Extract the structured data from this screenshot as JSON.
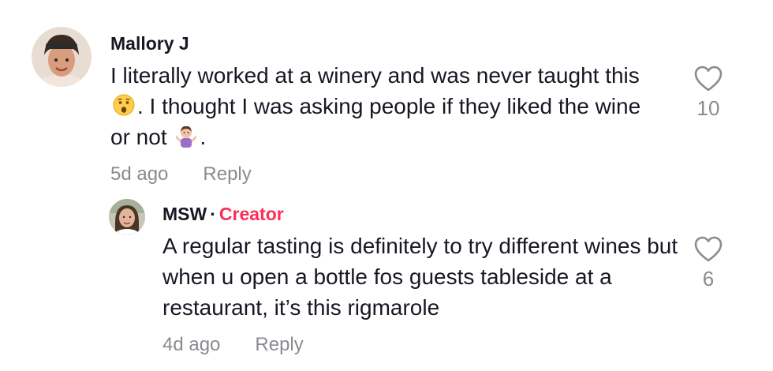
{
  "comments": [
    {
      "author": "Mallory J",
      "text_part1": "I literally worked at a winery and was never taught this",
      "text_part2": ". I thought I was asking people if they liked the wine or not",
      "text_part3": ".",
      "emoji1": "surprised-face-emoji",
      "emoji2": "person-shrugging-emoji",
      "time": "5d ago",
      "reply_label": "Reply",
      "likes": "10",
      "avatar": "woman-headband-avatar"
    }
  ],
  "reply": {
    "author": "MSW",
    "separator": "·",
    "badge": "Creator",
    "text": "A regular tasting is definitely to try different wines but when u open a bottle fos guests tableside at a restaurant, it’s this rigmarole",
    "time": "4d ago",
    "reply_label": "Reply",
    "likes": "6",
    "avatar": "woman-portrait-avatar"
  },
  "colors": {
    "text": "#161823",
    "muted": "#8a8b91",
    "creator": "#fe2c55"
  }
}
